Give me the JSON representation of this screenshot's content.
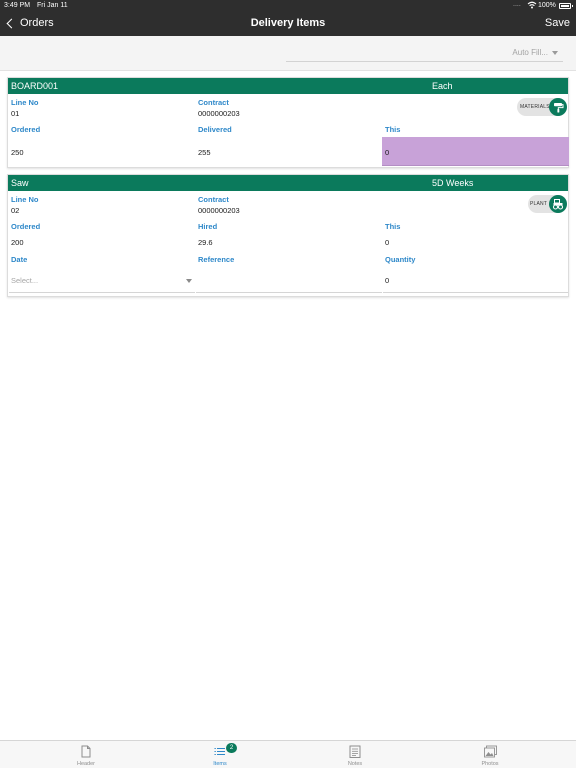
{
  "status_bar": {
    "time": "3:49 PM",
    "date": "Fri Jan 11",
    "battery": "100%"
  },
  "nav": {
    "back_label": "Orders",
    "title": "Delivery Items",
    "save_label": "Save"
  },
  "toolbar": {
    "autofill_label": "Auto Fill..."
  },
  "items": [
    {
      "name": "BOARD001",
      "unit": "Each",
      "line_no_label": "Line No",
      "line_no": "01",
      "contract_label": "Contract",
      "contract": "0000000203",
      "category": "MATERIALS",
      "ordered_label": "Ordered",
      "ordered": "250",
      "delivered_label": "Delivered",
      "delivered": "255",
      "this_label": "This",
      "this_value": "0"
    },
    {
      "name": "Saw",
      "unit": "5D Weeks",
      "line_no_label": "Line No",
      "line_no": "02",
      "contract_label": "Contract",
      "contract": "0000000203",
      "category": "PLANT",
      "ordered_label": "Ordered",
      "ordered": "200",
      "hired_label": "Hired",
      "hired": "29.6",
      "this_label": "This",
      "this_value": "0",
      "date_label": "Date",
      "date_placeholder": "Select...",
      "reference_label": "Reference",
      "reference": "",
      "quantity_label": "Quantity",
      "quantity": "0"
    }
  ],
  "tabs": [
    {
      "label": "Header",
      "icon": "document-icon"
    },
    {
      "label": "Items",
      "icon": "list-icon",
      "badge": "2"
    },
    {
      "label": "Notes",
      "icon": "notes-icon"
    },
    {
      "label": "Photos",
      "icon": "photos-icon"
    }
  ],
  "colors": {
    "accent": "#0b7a5c",
    "label_blue": "#2e88c9",
    "highlight": "#c8a2d8",
    "navbar": "#2e2e2e"
  }
}
